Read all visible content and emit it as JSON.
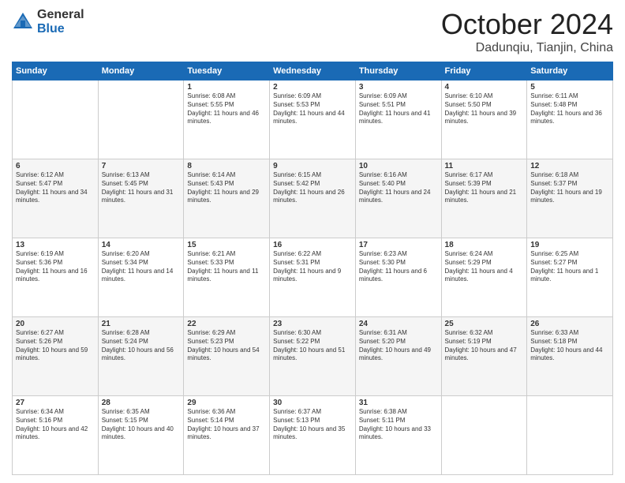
{
  "logo": {
    "general": "General",
    "blue": "Blue"
  },
  "title": "October 2024",
  "location": "Dadunqiu, Tianjin, China",
  "days_header": [
    "Sunday",
    "Monday",
    "Tuesday",
    "Wednesday",
    "Thursday",
    "Friday",
    "Saturday"
  ],
  "weeks": [
    [
      {
        "day": "",
        "sunrise": "",
        "sunset": "",
        "daylight": ""
      },
      {
        "day": "",
        "sunrise": "",
        "sunset": "",
        "daylight": ""
      },
      {
        "day": "1",
        "sunrise": "Sunrise: 6:08 AM",
        "sunset": "Sunset: 5:55 PM",
        "daylight": "Daylight: 11 hours and 46 minutes."
      },
      {
        "day": "2",
        "sunrise": "Sunrise: 6:09 AM",
        "sunset": "Sunset: 5:53 PM",
        "daylight": "Daylight: 11 hours and 44 minutes."
      },
      {
        "day": "3",
        "sunrise": "Sunrise: 6:09 AM",
        "sunset": "Sunset: 5:51 PM",
        "daylight": "Daylight: 11 hours and 41 minutes."
      },
      {
        "day": "4",
        "sunrise": "Sunrise: 6:10 AM",
        "sunset": "Sunset: 5:50 PM",
        "daylight": "Daylight: 11 hours and 39 minutes."
      },
      {
        "day": "5",
        "sunrise": "Sunrise: 6:11 AM",
        "sunset": "Sunset: 5:48 PM",
        "daylight": "Daylight: 11 hours and 36 minutes."
      }
    ],
    [
      {
        "day": "6",
        "sunrise": "Sunrise: 6:12 AM",
        "sunset": "Sunset: 5:47 PM",
        "daylight": "Daylight: 11 hours and 34 minutes."
      },
      {
        "day": "7",
        "sunrise": "Sunrise: 6:13 AM",
        "sunset": "Sunset: 5:45 PM",
        "daylight": "Daylight: 11 hours and 31 minutes."
      },
      {
        "day": "8",
        "sunrise": "Sunrise: 6:14 AM",
        "sunset": "Sunset: 5:43 PM",
        "daylight": "Daylight: 11 hours and 29 minutes."
      },
      {
        "day": "9",
        "sunrise": "Sunrise: 6:15 AM",
        "sunset": "Sunset: 5:42 PM",
        "daylight": "Daylight: 11 hours and 26 minutes."
      },
      {
        "day": "10",
        "sunrise": "Sunrise: 6:16 AM",
        "sunset": "Sunset: 5:40 PM",
        "daylight": "Daylight: 11 hours and 24 minutes."
      },
      {
        "day": "11",
        "sunrise": "Sunrise: 6:17 AM",
        "sunset": "Sunset: 5:39 PM",
        "daylight": "Daylight: 11 hours and 21 minutes."
      },
      {
        "day": "12",
        "sunrise": "Sunrise: 6:18 AM",
        "sunset": "Sunset: 5:37 PM",
        "daylight": "Daylight: 11 hours and 19 minutes."
      }
    ],
    [
      {
        "day": "13",
        "sunrise": "Sunrise: 6:19 AM",
        "sunset": "Sunset: 5:36 PM",
        "daylight": "Daylight: 11 hours and 16 minutes."
      },
      {
        "day": "14",
        "sunrise": "Sunrise: 6:20 AM",
        "sunset": "Sunset: 5:34 PM",
        "daylight": "Daylight: 11 hours and 14 minutes."
      },
      {
        "day": "15",
        "sunrise": "Sunrise: 6:21 AM",
        "sunset": "Sunset: 5:33 PM",
        "daylight": "Daylight: 11 hours and 11 minutes."
      },
      {
        "day": "16",
        "sunrise": "Sunrise: 6:22 AM",
        "sunset": "Sunset: 5:31 PM",
        "daylight": "Daylight: 11 hours and 9 minutes."
      },
      {
        "day": "17",
        "sunrise": "Sunrise: 6:23 AM",
        "sunset": "Sunset: 5:30 PM",
        "daylight": "Daylight: 11 hours and 6 minutes."
      },
      {
        "day": "18",
        "sunrise": "Sunrise: 6:24 AM",
        "sunset": "Sunset: 5:29 PM",
        "daylight": "Daylight: 11 hours and 4 minutes."
      },
      {
        "day": "19",
        "sunrise": "Sunrise: 6:25 AM",
        "sunset": "Sunset: 5:27 PM",
        "daylight": "Daylight: 11 hours and 1 minute."
      }
    ],
    [
      {
        "day": "20",
        "sunrise": "Sunrise: 6:27 AM",
        "sunset": "Sunset: 5:26 PM",
        "daylight": "Daylight: 10 hours and 59 minutes."
      },
      {
        "day": "21",
        "sunrise": "Sunrise: 6:28 AM",
        "sunset": "Sunset: 5:24 PM",
        "daylight": "Daylight: 10 hours and 56 minutes."
      },
      {
        "day": "22",
        "sunrise": "Sunrise: 6:29 AM",
        "sunset": "Sunset: 5:23 PM",
        "daylight": "Daylight: 10 hours and 54 minutes."
      },
      {
        "day": "23",
        "sunrise": "Sunrise: 6:30 AM",
        "sunset": "Sunset: 5:22 PM",
        "daylight": "Daylight: 10 hours and 51 minutes."
      },
      {
        "day": "24",
        "sunrise": "Sunrise: 6:31 AM",
        "sunset": "Sunset: 5:20 PM",
        "daylight": "Daylight: 10 hours and 49 minutes."
      },
      {
        "day": "25",
        "sunrise": "Sunrise: 6:32 AM",
        "sunset": "Sunset: 5:19 PM",
        "daylight": "Daylight: 10 hours and 47 minutes."
      },
      {
        "day": "26",
        "sunrise": "Sunrise: 6:33 AM",
        "sunset": "Sunset: 5:18 PM",
        "daylight": "Daylight: 10 hours and 44 minutes."
      }
    ],
    [
      {
        "day": "27",
        "sunrise": "Sunrise: 6:34 AM",
        "sunset": "Sunset: 5:16 PM",
        "daylight": "Daylight: 10 hours and 42 minutes."
      },
      {
        "day": "28",
        "sunrise": "Sunrise: 6:35 AM",
        "sunset": "Sunset: 5:15 PM",
        "daylight": "Daylight: 10 hours and 40 minutes."
      },
      {
        "day": "29",
        "sunrise": "Sunrise: 6:36 AM",
        "sunset": "Sunset: 5:14 PM",
        "daylight": "Daylight: 10 hours and 37 minutes."
      },
      {
        "day": "30",
        "sunrise": "Sunrise: 6:37 AM",
        "sunset": "Sunset: 5:13 PM",
        "daylight": "Daylight: 10 hours and 35 minutes."
      },
      {
        "day": "31",
        "sunrise": "Sunrise: 6:38 AM",
        "sunset": "Sunset: 5:11 PM",
        "daylight": "Daylight: 10 hours and 33 minutes."
      },
      {
        "day": "",
        "sunrise": "",
        "sunset": "",
        "daylight": ""
      },
      {
        "day": "",
        "sunrise": "",
        "sunset": "",
        "daylight": ""
      }
    ]
  ]
}
